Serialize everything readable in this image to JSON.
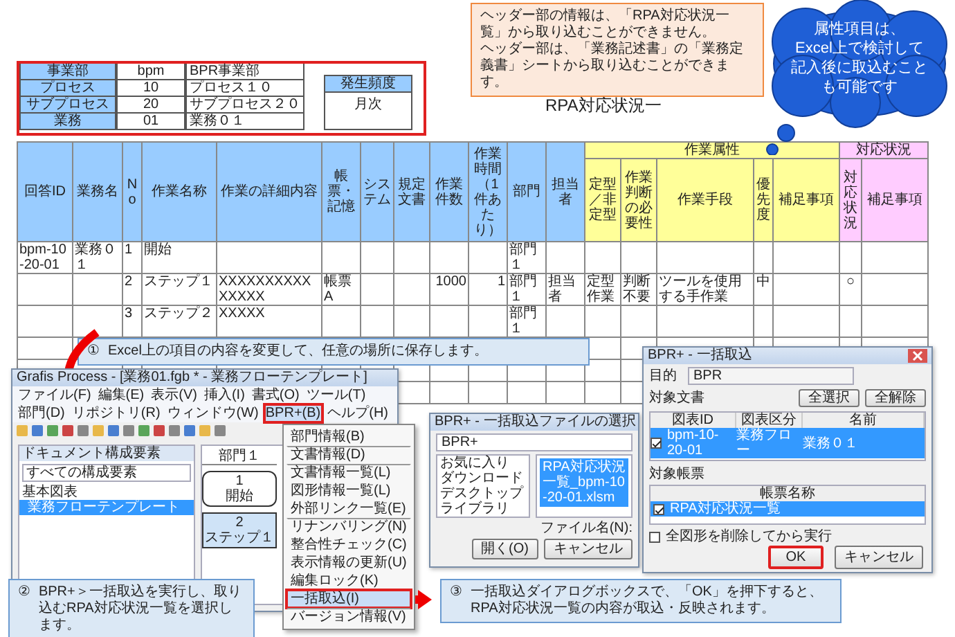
{
  "header_note": {
    "lines": [
      "ヘッダー部の情報は、「RPA対応状況一覧」から取り込むことができません。",
      "ヘッダー部は、「業務記述書」の「業務定義書」シートから取り込むことができます。"
    ]
  },
  "cloud_note": {
    "lines": [
      "属性項目は、",
      "Excel上で検討して",
      "記入後に取込むこと",
      "も可能です"
    ]
  },
  "sheet": {
    "header_fields": [
      {
        "label": "事業部",
        "code": "bpm",
        "value": "BPR事業部"
      },
      {
        "label": "プロセス",
        "code": "10",
        "value": "プロセス１０"
      },
      {
        "label": "サブプロセス",
        "code": "20",
        "value": "サブプロセス２０"
      },
      {
        "label": "業務",
        "code": "01",
        "value": "業務０１"
      }
    ],
    "frequency": {
      "label": "発生頻度",
      "value": "月次"
    },
    "title": "RPA対応状況一",
    "groups": [
      {
        "kind": "attribute",
        "label": "作業属性"
      },
      {
        "kind": "status",
        "label": "対応状況"
      }
    ],
    "columns": [
      {
        "label": "回答ID",
        "kind": "base"
      },
      {
        "label": "業務名",
        "kind": "base"
      },
      {
        "label": "No",
        "kind": "base"
      },
      {
        "label": "作業名称",
        "kind": "base"
      },
      {
        "label": "作業の詳細内容",
        "kind": "base"
      },
      {
        "label": "帳票・記憶",
        "kind": "base"
      },
      {
        "label": "システム",
        "kind": "base"
      },
      {
        "label": "規定文書",
        "kind": "base"
      },
      {
        "label": "作業件数",
        "kind": "base"
      },
      {
        "label": "作業時間（1件あたり）",
        "kind": "base"
      },
      {
        "label": "部門",
        "kind": "base"
      },
      {
        "label": "担当者",
        "kind": "base"
      },
      {
        "label": "定型／非定型",
        "kind": "attribute"
      },
      {
        "label": "作業判断の必要性",
        "kind": "attribute"
      },
      {
        "label": "作業手段",
        "kind": "attribute"
      },
      {
        "label": "優先度",
        "kind": "attribute"
      },
      {
        "label": "補足事項",
        "kind": "attribute"
      },
      {
        "label": "対応状況",
        "kind": "status"
      },
      {
        "label": "補足事項",
        "kind": "status"
      }
    ],
    "rows": [
      {
        "cells": [
          "bpm-10-20-01",
          "業務０１",
          "1",
          "開始",
          null,
          null,
          null,
          null,
          null,
          null,
          "部門１",
          null,
          null,
          null,
          null,
          null,
          null,
          null,
          null
        ]
      },
      {
        "cells": [
          null,
          null,
          "2",
          "ステップ１",
          "XXXXXXXXXXXXXXX",
          "帳票A",
          null,
          null,
          "1000",
          "1",
          "部門１",
          "担当者",
          "定型作業",
          "判断不要",
          "ツールを使用する手作業",
          "中",
          null,
          "○",
          null
        ]
      },
      {
        "cells": [
          null,
          null,
          "3",
          "ステップ２",
          "XXXXX",
          null,
          null,
          null,
          null,
          null,
          "部門１",
          null,
          null,
          null,
          null,
          null,
          null,
          null,
          null
        ]
      }
    ]
  },
  "step1_note": {
    "number": "①",
    "text": "Excel上の項目の内容を変更して、任意の場所に保存します。"
  },
  "grafis": {
    "title": "Grafis Process - [業務01.fgb * - 業務フローテンプレート]",
    "menu": [
      {
        "label": "ファイル(F)",
        "open": false
      },
      {
        "label": "編集(E)",
        "open": false
      },
      {
        "label": "表示(V)",
        "open": false
      },
      {
        "label": "挿入(I)",
        "open": false
      },
      {
        "label": "書式(O)",
        "open": false
      },
      {
        "label": "ツール(T)",
        "open": false
      },
      {
        "label": "部門(D)",
        "open": false
      },
      {
        "label": "リポジトリ(R)",
        "open": false
      },
      {
        "label": "ウィンドウ(W)",
        "open": false
      },
      {
        "label": "BPR+(B)",
        "open": true
      },
      {
        "label": "ヘルプ(H)",
        "open": false
      }
    ],
    "panel_title": "ドキュメント構成要素",
    "panel_filter": "すべての構成要素",
    "tree": [
      {
        "label": "基本図表",
        "selected": false,
        "children": [
          {
            "label": "業務フローテンプレート",
            "selected": true
          }
        ]
      }
    ],
    "lane": "部門１",
    "nodes": [
      {
        "kind": "start",
        "number": "1",
        "label": "開始"
      },
      {
        "kind": "step",
        "number": "2",
        "label": "ステップ１"
      }
    ],
    "dropdown": [
      {
        "label": "部門情報(B)",
        "separator_above": false,
        "selected": false
      },
      {
        "label": "文書情報(D)",
        "separator_above": true,
        "selected": false
      },
      {
        "label": "文書情報一覧(L)",
        "separator_above": true,
        "selected": false
      },
      {
        "label": "図形情報一覧(L)",
        "separator_above": false,
        "selected": false
      },
      {
        "label": "外部リンク一覧(E)",
        "separator_above": false,
        "selected": false
      },
      {
        "label": "リナンバリング(N)",
        "separator_above": true,
        "selected": false
      },
      {
        "label": "整合性チェック(C)",
        "separator_above": false,
        "selected": false
      },
      {
        "label": "表示情報の更新(U)",
        "separator_above": false,
        "selected": false
      },
      {
        "label": "編集ロック(K)",
        "separator_above": false,
        "selected": false
      },
      {
        "label": "一括取込(I)",
        "separator_above": true,
        "selected": true
      },
      {
        "label": "バージョン情報(V)",
        "separator_above": true,
        "selected": false
      }
    ]
  },
  "step2_note": {
    "number": "②",
    "text": "BPR+＞一括取込を実行し、取り込むRPA対応状況一覧を選択します。"
  },
  "file_dialog": {
    "title": "BPR+ - 一括取込ファイルの選択",
    "address": "BPR+",
    "nav": [
      "お気に入り",
      "ダウンロード",
      "デスクトップ",
      "ライブラリ"
    ],
    "files": [
      {
        "name": "RPA対応状況一覧_bpm-10-20-01.xlsm",
        "selected": true
      }
    ],
    "filename_label": "ファイル名(N):",
    "buttons": [
      "開く(O)",
      "キャンセル"
    ]
  },
  "import_dialog": {
    "title": "BPR+ - 一括取込",
    "purpose_label": "目的",
    "purpose": "BPR",
    "docs_label": "対象文書",
    "doc_buttons": [
      "全選択",
      "全解除"
    ],
    "doc_columns": [
      "図表ID",
      "図表区分",
      "名前"
    ],
    "docs": [
      {
        "cells": [
          "bpm-10-20-01",
          "業務フロー",
          "業務０１"
        ],
        "checked": true,
        "selected": true
      }
    ],
    "forms_label": "対象帳票",
    "form_column": "帳票名称",
    "forms": [
      {
        "name": "RPA対応状況一覧",
        "checked": true,
        "selected": true
      }
    ],
    "option": {
      "label": "全図形を削除してから実行",
      "checked": false
    },
    "buttons": [
      {
        "label": "OK",
        "highlighted": true
      },
      {
        "label": "キャンセル",
        "highlighted": false
      }
    ]
  },
  "step3_note": {
    "number": "③",
    "text": "一括取込ダイアログボックスで、「OK」を押下すると、RPA対応状況一覧の内容が取込・反映されます。"
  }
}
